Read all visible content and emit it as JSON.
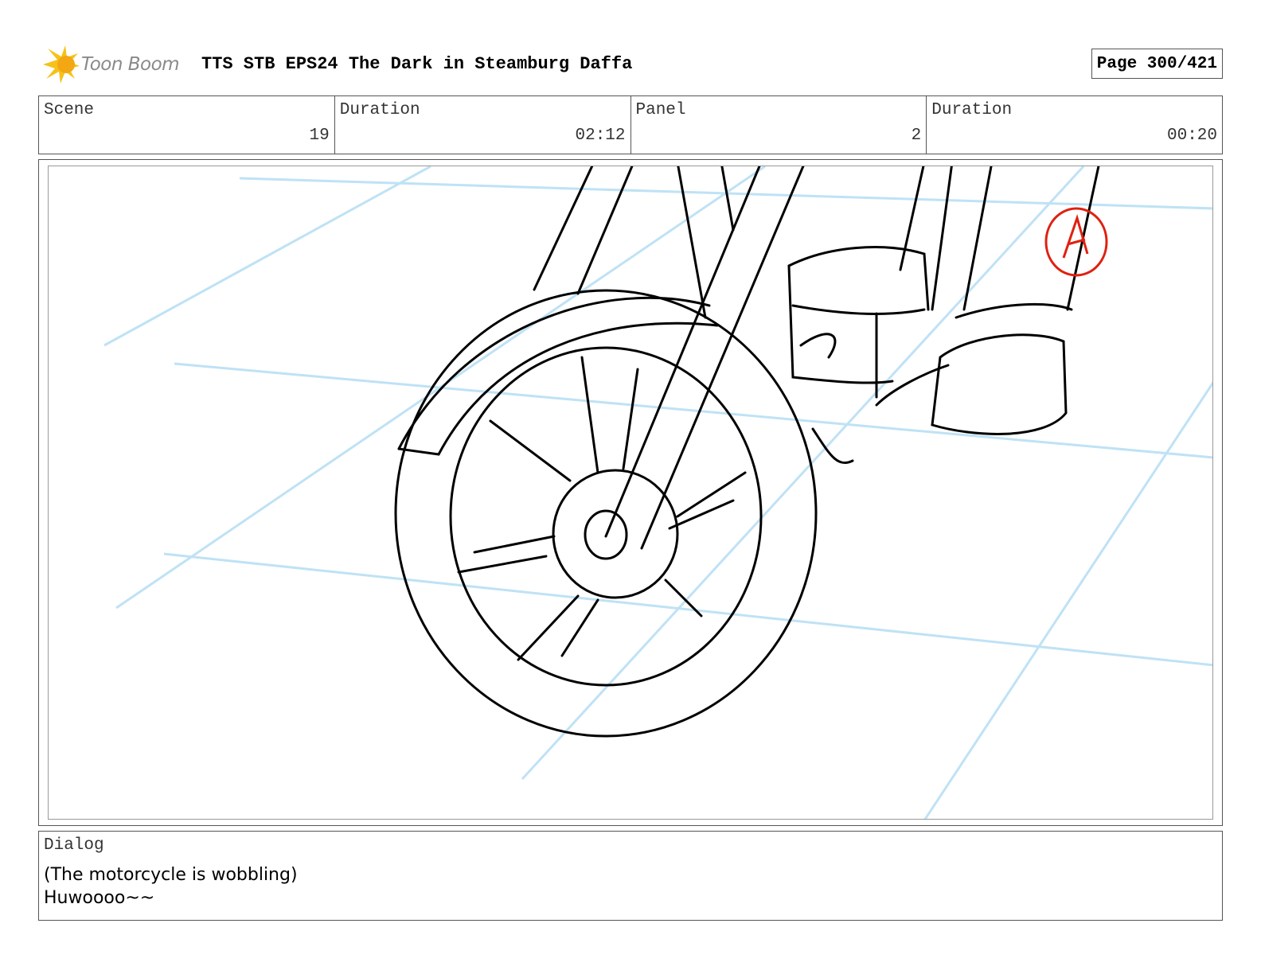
{
  "header": {
    "logo_text": "Toon Boom",
    "doc_title": "TTS STB EPS24 The Dark in Steamburg Daffa",
    "page_label": "Page 300/421"
  },
  "info": {
    "scene_label": "Scene",
    "scene_value": "19",
    "scene_duration_label": "Duration",
    "scene_duration_value": "02:12",
    "panel_label": "Panel",
    "panel_value": "2",
    "panel_duration_label": "Duration",
    "panel_duration_value": "00:20"
  },
  "panel": {
    "marker_letter": "A",
    "colors": {
      "sketch": "#000000",
      "guide": "#bfe2f5",
      "marker": "#e02010"
    }
  },
  "dialog": {
    "label": "Dialog",
    "text": "(The motorcycle is wobbling)\nHuwoooo~~"
  }
}
